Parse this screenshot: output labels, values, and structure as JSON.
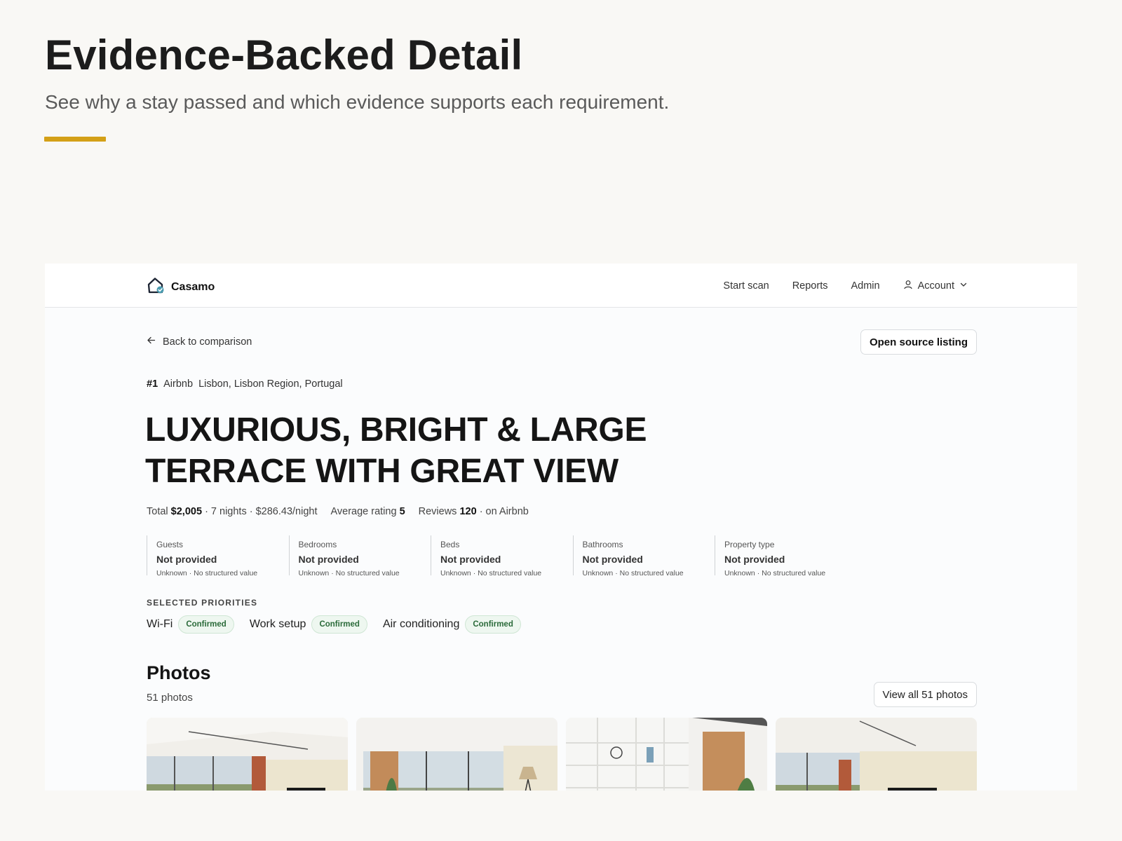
{
  "slide": {
    "title": "Evidence-Backed Detail",
    "subtitle": "See why a stay passed and which evidence supports each requirement.",
    "accent_color": "#d4a017"
  },
  "app": {
    "brand": "Casamo",
    "logo_icon": "house-check-icon",
    "nav": [
      "Start scan",
      "Reports",
      "Admin"
    ],
    "account_label": "Account"
  },
  "listing": {
    "back_label": "Back to comparison",
    "open_source_label": "Open source listing",
    "rank": "#1",
    "platform": "Airbnb",
    "location": "Lisbon, Lisbon Region, Portugal",
    "title": "LUXURIOUS, BRIGHT & LARGE TERRACE WITH GREAT VIEW",
    "total_label": "Total",
    "total_value": "$2,005",
    "price_detail": "· 7 nights · $286.43/night",
    "rating_label": "Average rating",
    "rating_value": "5",
    "reviews_label": "Reviews",
    "reviews_value": "120",
    "reviews_source": "· on Airbnb"
  },
  "facts": [
    {
      "label": "Guests",
      "value": "Not provided",
      "note": "Unknown · No structured value"
    },
    {
      "label": "Bedrooms",
      "value": "Not provided",
      "note": "Unknown · No structured value"
    },
    {
      "label": "Beds",
      "value": "Not provided",
      "note": "Unknown · No structured value"
    },
    {
      "label": "Bathrooms",
      "value": "Not provided",
      "note": "Unknown · No structured value"
    },
    {
      "label": "Property type",
      "value": "Not provided",
      "note": "Unknown · No structured value"
    }
  ],
  "priorities": {
    "heading": "SELECTED PRIORITIES",
    "items": [
      {
        "name": "Wi-Fi",
        "status": "Confirmed"
      },
      {
        "name": "Work setup",
        "status": "Confirmed"
      },
      {
        "name": "Air conditioning",
        "status": "Confirmed"
      }
    ]
  },
  "photos": {
    "title": "Photos",
    "count_label": "51 photos",
    "view_all_label": "View all 51 photos",
    "thumbnails": [
      "living-room-photo",
      "terrace-view-photo",
      "shelving-photo",
      "living-room-photo"
    ]
  }
}
